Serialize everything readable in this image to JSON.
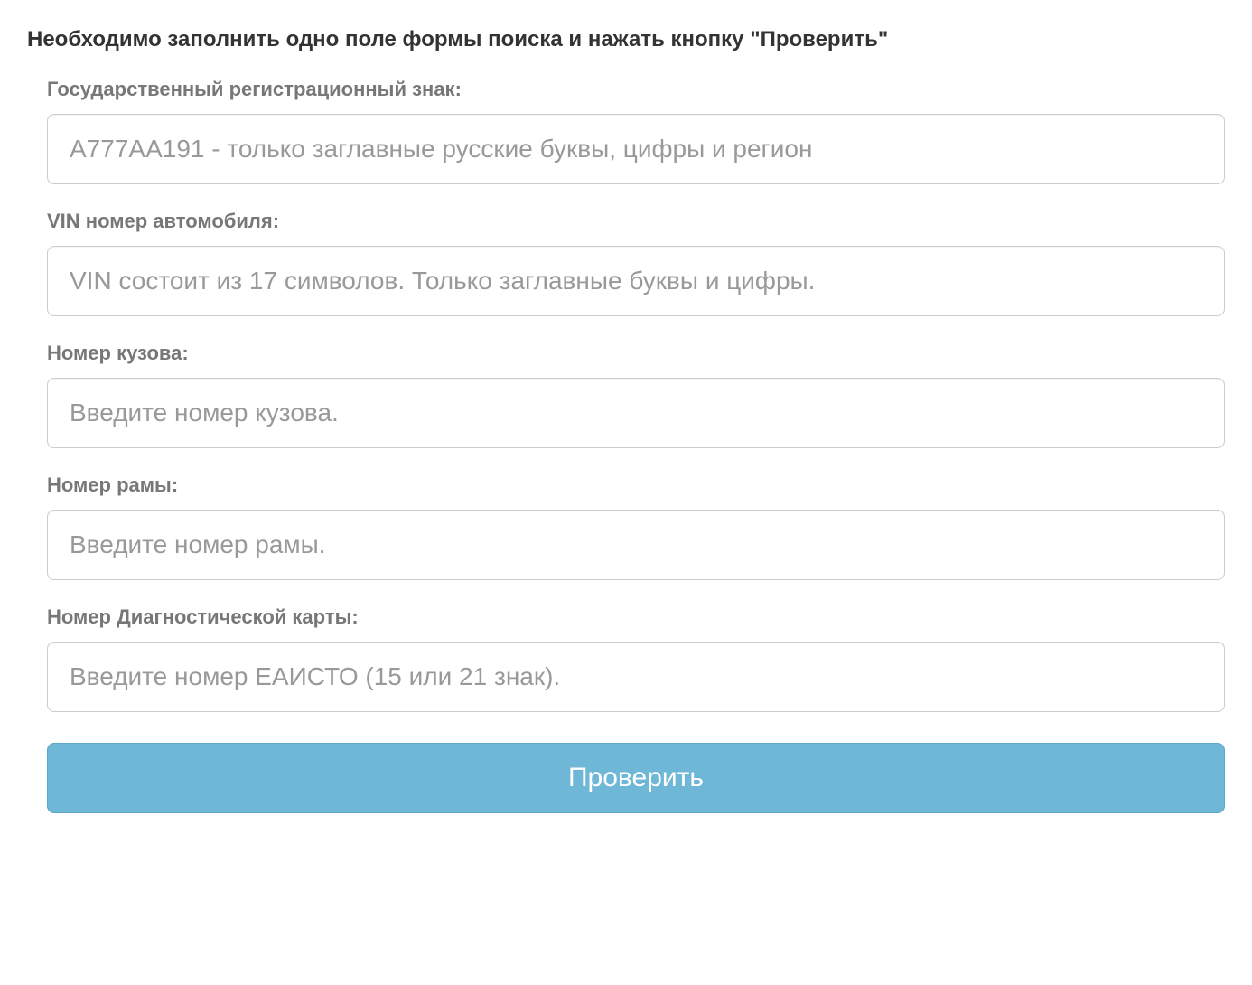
{
  "form": {
    "title": "Необходимо заполнить одно поле формы поиска и нажать кнопку \"Проверить\"",
    "fields": {
      "regPlate": {
        "label": "Государственный регистрационный знак:",
        "placeholder": "А777АА191 - только заглавные русские буквы, цифры и регион",
        "value": ""
      },
      "vin": {
        "label": "VIN номер автомобиля:",
        "placeholder": "VIN состоит из 17 символов. Только заглавные буквы и цифры.",
        "value": ""
      },
      "bodyNumber": {
        "label": "Номер кузова:",
        "placeholder": "Введите номер кузова.",
        "value": ""
      },
      "frameNumber": {
        "label": "Номер рамы:",
        "placeholder": "Введите номер рамы.",
        "value": ""
      },
      "diagCard": {
        "label": "Номер Диагностической карты:",
        "placeholder": "Введите номер ЕАИСТО (15 или 21 знак).",
        "value": ""
      }
    },
    "submitLabel": "Проверить"
  },
  "colors": {
    "buttonBg": "#6fb7d6",
    "buttonBorder": "#5aa9cb",
    "labelText": "#777777",
    "titleText": "#333333",
    "inputBorder": "#cccccc",
    "placeholder": "#999999"
  }
}
